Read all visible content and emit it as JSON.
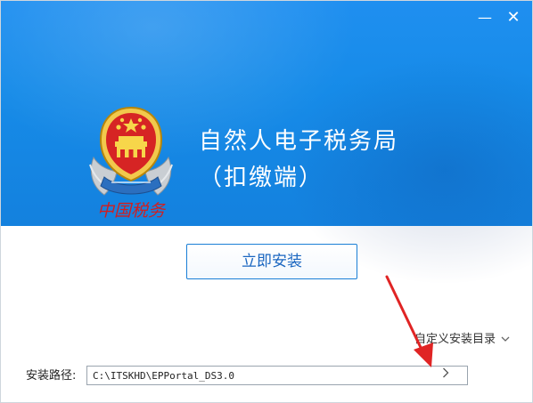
{
  "window": {
    "minimize_glyph": "—",
    "close_glyph": "✕"
  },
  "header": {
    "title_line1": "自然人电子税务局",
    "title_line2": "（扣缴端）",
    "logo_caption": "中国税务"
  },
  "main": {
    "install_label": "立即安装",
    "custom_dir_label": "自定义安装目录",
    "custom_dir_icon": "chevron-down-icon"
  },
  "path": {
    "label": "安装路径:",
    "value": "C:\\ITSKHD\\EPPortal_DS3.0",
    "browse_icon": "chevron-right-icon"
  },
  "colors": {
    "banner": "#1785e6",
    "button_border": "#1a7fd6",
    "button_text": "#1a66c0",
    "arrow": "#e02424"
  }
}
